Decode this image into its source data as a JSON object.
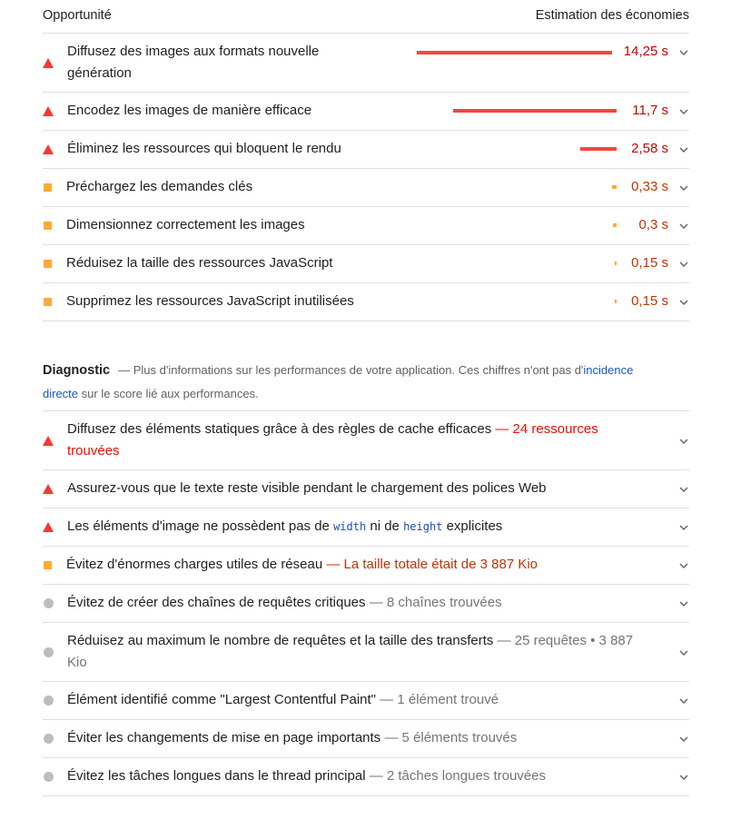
{
  "opportunities": {
    "header_left": "Opportunité",
    "header_right": "Estimation des économies",
    "items": [
      {
        "title": "Diffusez des images aux formats nouvelle génération",
        "value": "14,25 s",
        "severity": "fail",
        "savings_fraction": 1.0
      },
      {
        "title": "Encodez les images de manière efficace",
        "value": "11,7 s",
        "severity": "fail",
        "savings_fraction": 0.84
      },
      {
        "title": "Éliminez les ressources qui bloquent le rendu",
        "value": "2,58 s",
        "severity": "fail",
        "savings_fraction": 0.19
      },
      {
        "title": "Préchargez les demandes clés",
        "value": "0,33 s",
        "severity": "average",
        "savings_fraction": 0.03
      },
      {
        "title": "Dimensionnez correctement les images",
        "value": "0,3 s",
        "severity": "average",
        "savings_fraction": 0.025
      },
      {
        "title": "Réduisez la taille des ressources JavaScript",
        "value": "0,15 s",
        "severity": "average",
        "savings_fraction": 0.012
      },
      {
        "title": "Supprimez les ressources JavaScript inutilisées",
        "value": "0,15 s",
        "severity": "average",
        "savings_fraction": 0.012
      }
    ]
  },
  "diagnostics": {
    "heading": "Diagnostic",
    "desc_before": "— Plus d'informations sur les performances de votre application. Ces chiffres n'ont pas d'",
    "desc_link": "incidence directe",
    "desc_after": " sur le score lié aux performances.",
    "items": [
      {
        "title": "Diffusez des éléments statiques grâce à des règles de cache efficaces",
        "sub": "— 24 ressources trouvées",
        "severity": "fail"
      },
      {
        "title": "Assurez-vous que le texte reste visible pendant le chargement des polices Web",
        "sub": "",
        "severity": "fail"
      },
      {
        "title_a": "Les éléments d'image ne possèdent pas de ",
        "code_a": "width",
        "title_b": " ni de ",
        "code_b": "height",
        "title_c": " explicites",
        "severity": "fail"
      },
      {
        "title": "Évitez d'énormes charges utiles de réseau",
        "sub": "— La taille totale était de 3 887 Kio",
        "severity": "average"
      },
      {
        "title": "Évitez de créer des chaînes de requêtes critiques",
        "sub": "— 8 chaînes trouvées",
        "severity": "info"
      },
      {
        "title": "Réduisez au maximum le nombre de requêtes et la taille des transferts",
        "sub": "— 25 requêtes • 3 887 Kio",
        "severity": "info"
      },
      {
        "title": "Élément identifié comme \"Largest Contentful Paint\"",
        "sub": "— 1 élément trouvé",
        "severity": "info"
      },
      {
        "title": "Éviter les changements de mise en page importants",
        "sub": "— 5 éléments trouvés",
        "severity": "info"
      },
      {
        "title": "Évitez les tâches longues dans le thread principal",
        "sub": "— 2 tâches longues trouvées",
        "severity": "info"
      }
    ]
  },
  "colors": {
    "fail": "#f33",
    "average": "#fa3",
    "info": "#bdbdbd",
    "link": "#1a55c8"
  }
}
